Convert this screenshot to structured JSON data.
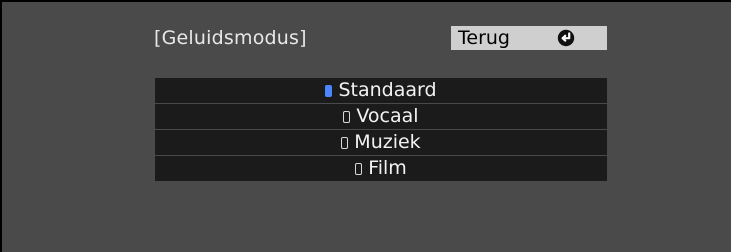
{
  "menu": {
    "title": "[Geluidsmodus]",
    "back_label": "Terug",
    "back_icon": "enter-return-icon",
    "options": [
      {
        "label": "Standaard",
        "selected": true
      },
      {
        "label": "Vocaal",
        "selected": false
      },
      {
        "label": "Muziek",
        "selected": false
      },
      {
        "label": "Film",
        "selected": false
      }
    ]
  },
  "colors": {
    "background": "#4a4a4a",
    "row_background": "#1b1b1b",
    "button_background": "#cfcfcf",
    "selected_indicator": "#4a86ff"
  }
}
